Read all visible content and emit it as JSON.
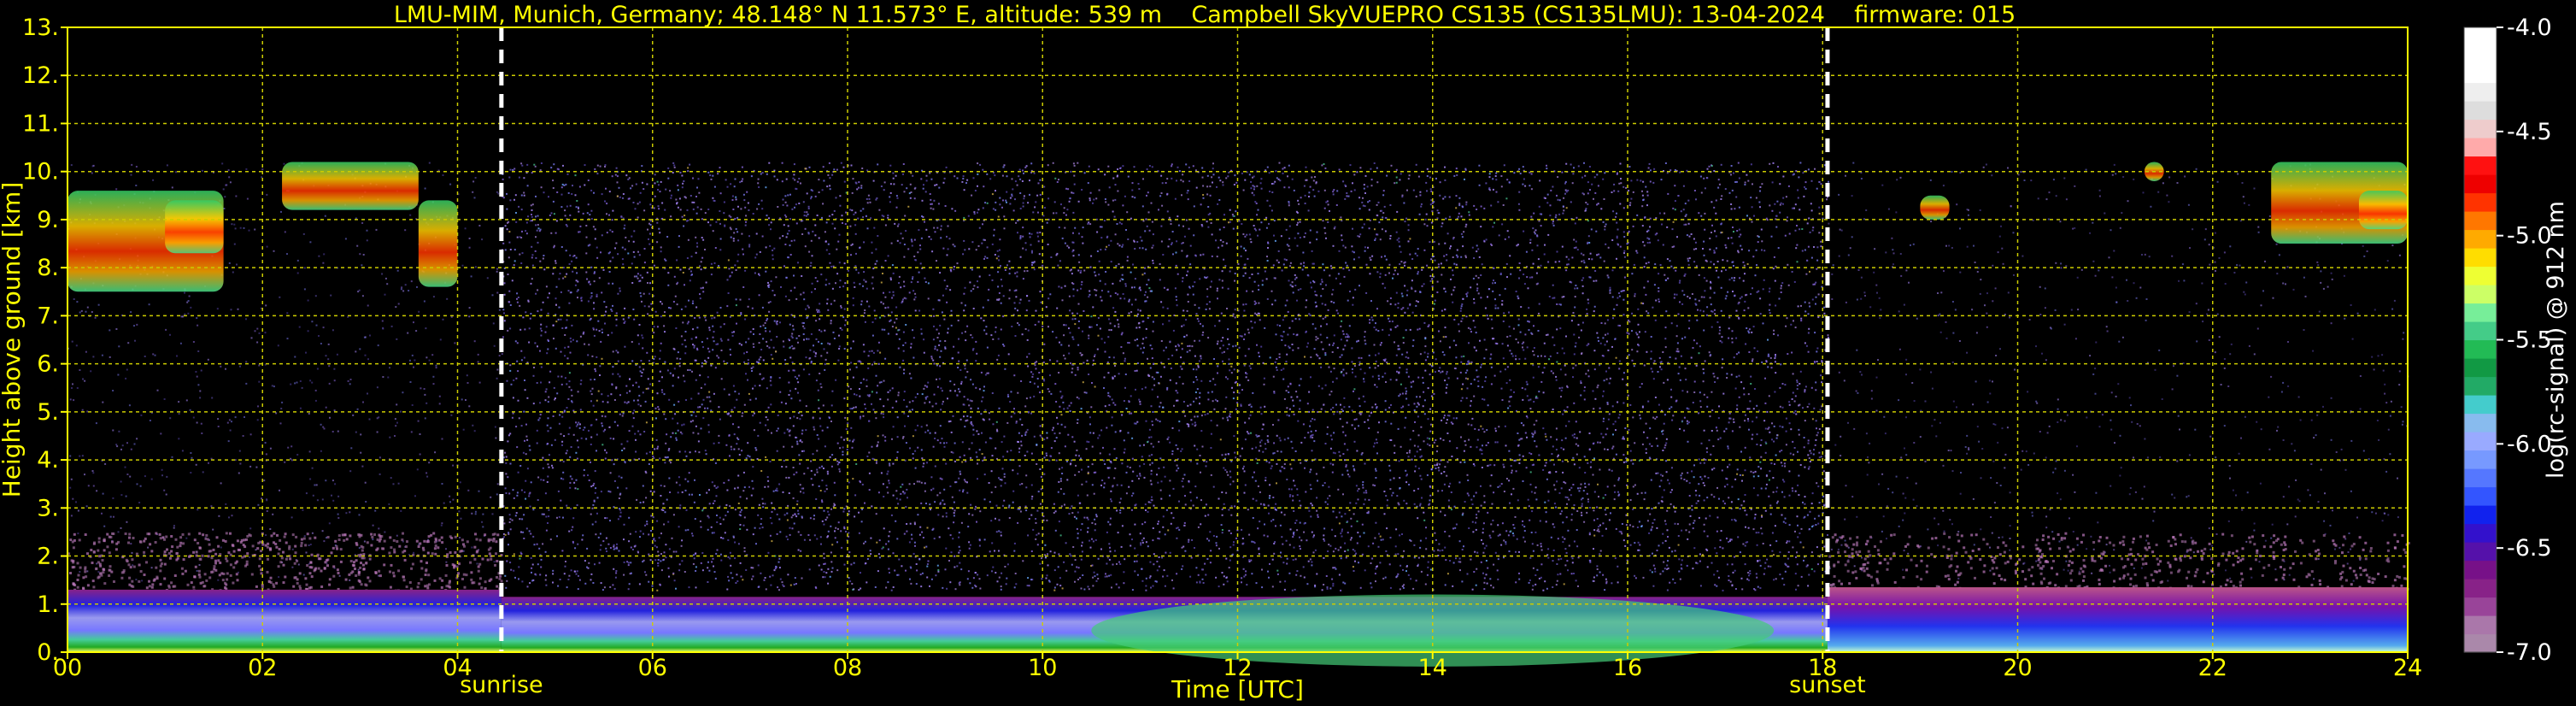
{
  "header": {
    "title": "LMU-MIM, Munich, Germany; 48.148° N 11.573° E, altitude: 539 m    Campbell SkyVUEPRO CS135 (CS135LMU): 13-04-2024    firmware: 015"
  },
  "chart_data": {
    "type": "heatmap",
    "xlabel": "Time [UTC]",
    "ylabel": "Height above ground [km]",
    "xlim": [
      0,
      24
    ],
    "ylim": [
      0,
      13
    ],
    "xticks": [
      "00",
      "02",
      "04",
      "06",
      "08",
      "10",
      "12",
      "14",
      "16",
      "18",
      "20",
      "22",
      "24"
    ],
    "yticks": [
      "0.",
      "1.",
      "2.",
      "3.",
      "4.",
      "5.",
      "6.",
      "7.",
      "8.",
      "9.",
      "10.",
      "11.",
      "12.",
      "13."
    ],
    "grid": true,
    "annotations": [
      {
        "label": "sunrise",
        "x": 4.45
      },
      {
        "label": "sunset",
        "x": 18.05
      }
    ],
    "colorbar": {
      "label": "log(rc-signal) @ 912 nm",
      "range": [
        -7.0,
        -4.0
      ],
      "ticks": [
        "-7.0",
        "-6.5",
        "-6.0",
        "-5.5",
        "-5.0",
        "-4.5",
        "-4.0"
      ]
    },
    "features": [
      {
        "name": "aerosol boundary layer",
        "x": [
          0,
          24
        ],
        "height_km": [
          0,
          1.3
        ]
      },
      {
        "name": "cirrus clouds",
        "x": [
          0,
          4.2
        ],
        "height_km": [
          7.4,
          10.2
        ]
      },
      {
        "name": "cirrus clouds",
        "x": [
          19,
          24
        ],
        "height_km": [
          8.2,
          10.2
        ]
      },
      {
        "name": "background noise",
        "x": [
          0,
          24
        ],
        "height_km": [
          1.3,
          10.2
        ]
      }
    ]
  }
}
